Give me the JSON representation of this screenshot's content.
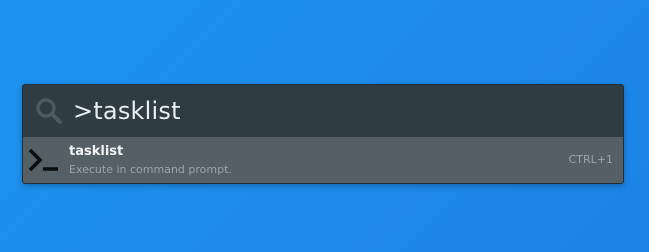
{
  "launcher": {
    "search": {
      "query": ">tasklist",
      "icon": "search-icon"
    },
    "results": [
      {
        "title": "tasklist",
        "subtitle": "Execute in command prompt.",
        "hotkey": "CTRL+1",
        "icon": "terminal-icon"
      }
    ]
  },
  "colors": {
    "desktop_background": "#1e8ceb",
    "search_bar_background": "#2f3c43",
    "selected_result_background": "#555f66"
  }
}
